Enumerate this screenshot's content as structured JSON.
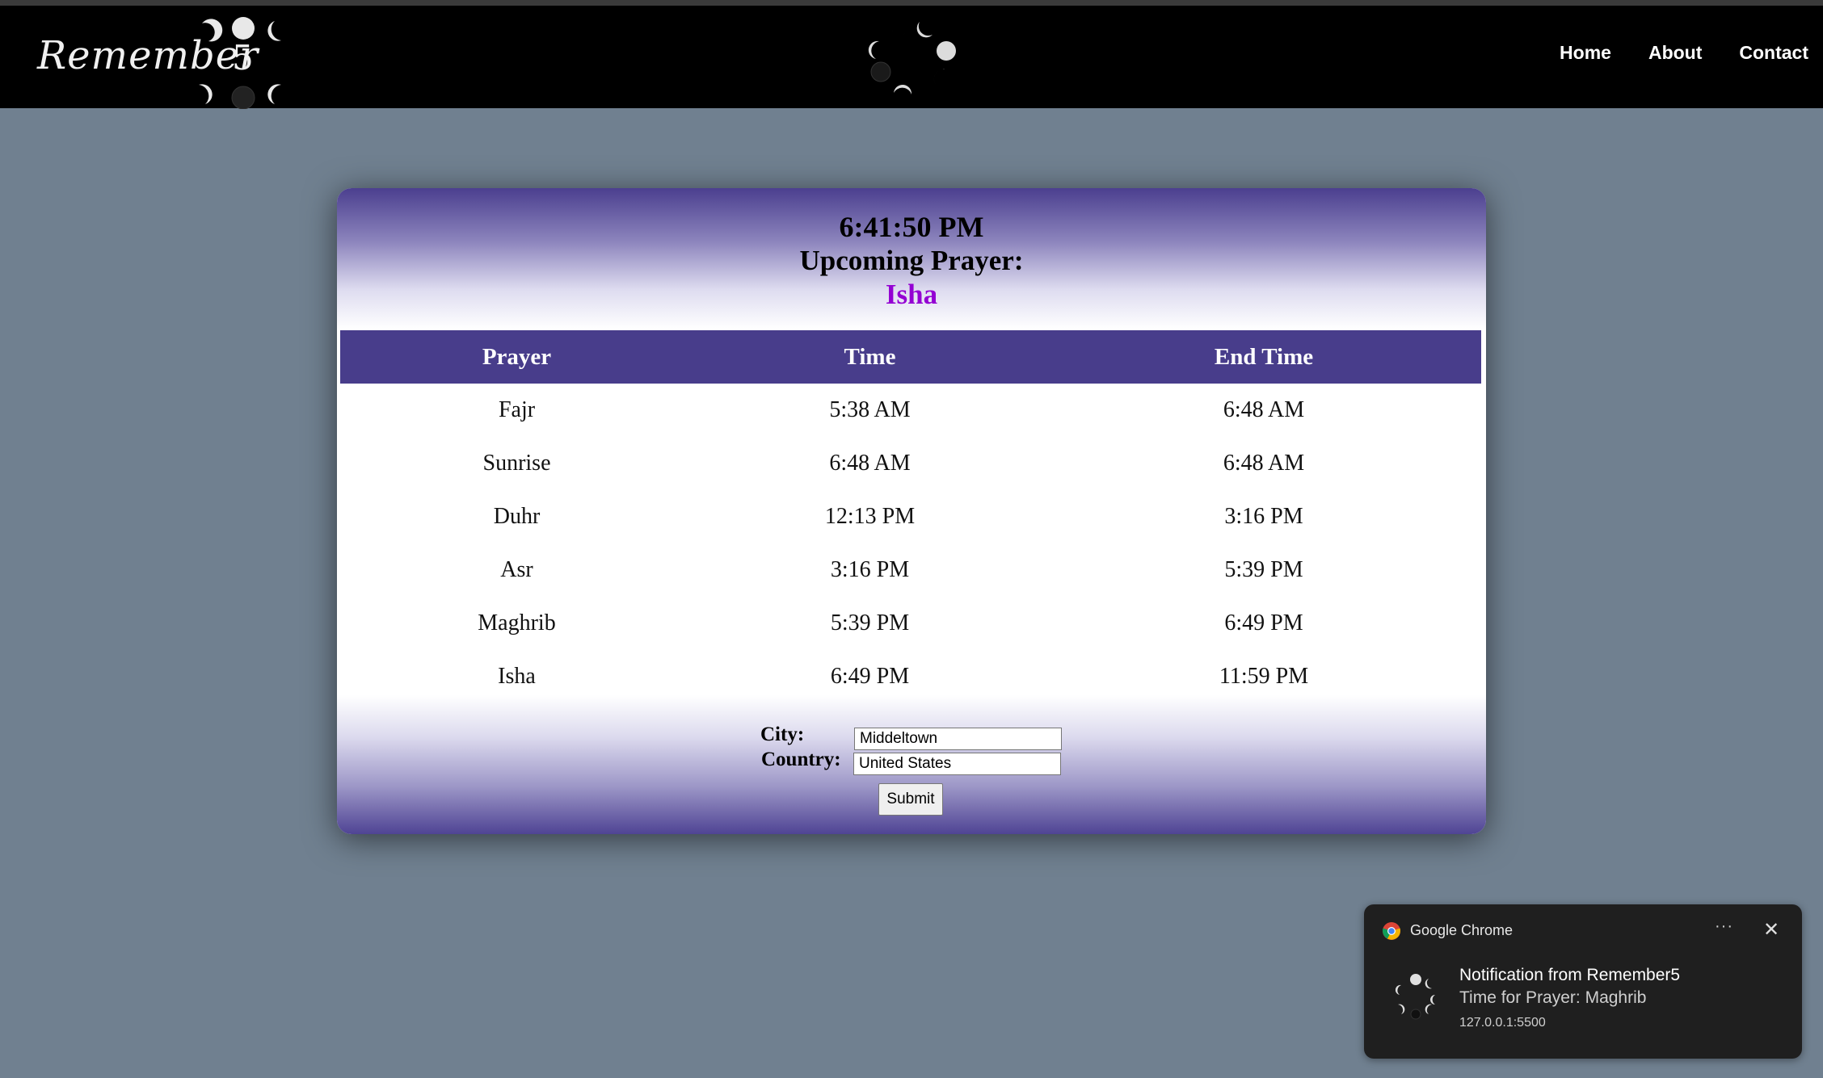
{
  "brand": {
    "logo_text": "Remember",
    "logo_number": "5"
  },
  "nav": {
    "home": "Home",
    "about": "About",
    "contact": "Contact"
  },
  "status": {
    "clock": "6:41:50 PM",
    "upcoming_label": "Upcoming Prayer:",
    "upcoming_name": "Isha",
    "upcoming_color": "#9400d3"
  },
  "table": {
    "headers": [
      "Prayer",
      "Time",
      "End Time"
    ],
    "rows": [
      [
        "Fajr",
        "5:38 AM",
        "6:48 AM"
      ],
      [
        "Sunrise",
        "6:48 AM",
        "6:48 AM"
      ],
      [
        "Duhr",
        "12:13 PM",
        "3:16 PM"
      ],
      [
        "Asr",
        "3:16 PM",
        "5:39 PM"
      ],
      [
        "Maghrib",
        "5:39 PM",
        "6:49 PM"
      ],
      [
        "Isha",
        "6:49 PM",
        "11:59 PM"
      ]
    ]
  },
  "form": {
    "city_label": "City:",
    "city_value": "Middeltown",
    "country_label": "Country:",
    "country_value": "United States",
    "submit_label": "Submit"
  },
  "notification": {
    "app_name": "Google Chrome",
    "more_label": "···",
    "close_label": "✕",
    "title": "Notification from Remember5",
    "body": "Time for Prayer: Maghrib",
    "source": "127.0.0.1:5500"
  },
  "colors": {
    "page_bg": "#708090",
    "header_bg": "#000000",
    "table_header_bg": "#483d8b",
    "accent_purple": "#9400d3"
  }
}
